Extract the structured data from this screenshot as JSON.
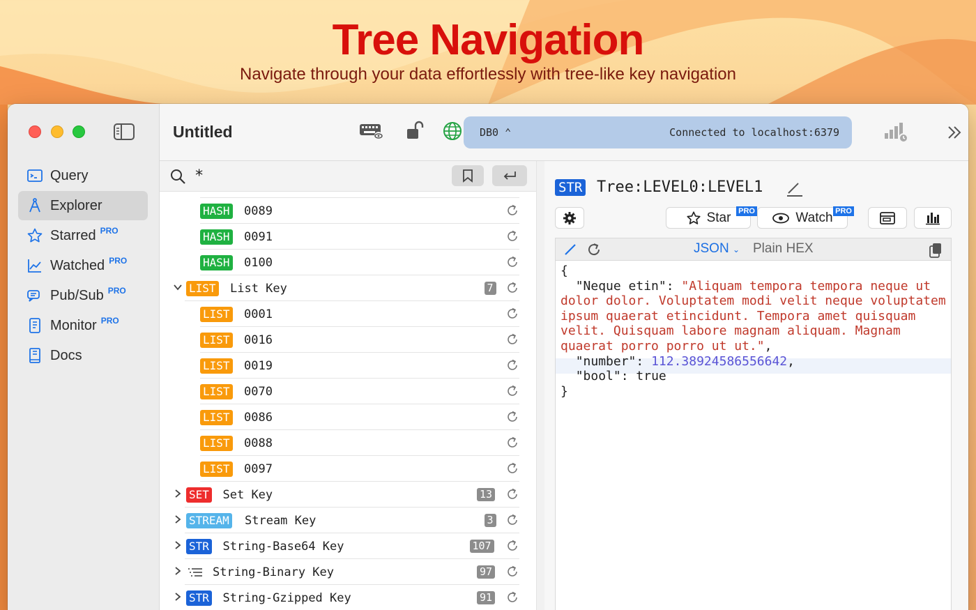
{
  "hero": {
    "title": "Tree Navigation",
    "subtitle": "Navigate through your data effortlessly with tree-like key navigation"
  },
  "window": {
    "title": "Untitled"
  },
  "sidebar": {
    "items": [
      {
        "label": "Query",
        "icon": "terminal-icon",
        "pro": ""
      },
      {
        "label": "Explorer",
        "icon": "compass-icon",
        "pro": "",
        "active": true
      },
      {
        "label": "Starred",
        "icon": "star-icon",
        "pro": "PRO"
      },
      {
        "label": "Watched",
        "icon": "chart-line-icon",
        "pro": "PRO"
      },
      {
        "label": "Pub/Sub",
        "icon": "chat-icon",
        "pro": "PRO"
      },
      {
        "label": "Monitor",
        "icon": "monitor-icon",
        "pro": "PRO"
      },
      {
        "label": "Docs",
        "icon": "book-icon",
        "pro": ""
      }
    ]
  },
  "toolbar": {
    "db": "DB0",
    "status": "Connected to localhost:6379"
  },
  "search": {
    "pattern": "*"
  },
  "tree": {
    "rows": [
      {
        "kind": "child",
        "type": "HASH",
        "name": "0089"
      },
      {
        "kind": "child",
        "type": "HASH",
        "name": "0091"
      },
      {
        "kind": "child",
        "type": "HASH",
        "name": "0100"
      },
      {
        "kind": "parent",
        "expanded": true,
        "type": "LIST",
        "name": "List Key",
        "count": "7"
      },
      {
        "kind": "child",
        "type": "LIST",
        "name": "0001"
      },
      {
        "kind": "child",
        "type": "LIST",
        "name": "0016"
      },
      {
        "kind": "child",
        "type": "LIST",
        "name": "0019"
      },
      {
        "kind": "child",
        "type": "LIST",
        "name": "0070"
      },
      {
        "kind": "child",
        "type": "LIST",
        "name": "0086"
      },
      {
        "kind": "child",
        "type": "LIST",
        "name": "0088"
      },
      {
        "kind": "child",
        "type": "LIST",
        "name": "0097"
      },
      {
        "kind": "parent",
        "expanded": false,
        "type": "SET",
        "name": "Set Key",
        "count": "13"
      },
      {
        "kind": "parent",
        "expanded": false,
        "type": "STREAM",
        "name": "Stream Key",
        "count": "3"
      },
      {
        "kind": "parent",
        "expanded": false,
        "type": "STR",
        "name": "String-Base64 Key",
        "count": "107"
      },
      {
        "kind": "parent",
        "expanded": false,
        "type": "BIN",
        "name": "String-Binary Key",
        "count": "97"
      },
      {
        "kind": "parent",
        "expanded": false,
        "type": "STR",
        "name": "String-Gzipped Key",
        "count": "91"
      }
    ]
  },
  "detail": {
    "type": "STR",
    "key": "Tree:LEVEL0:LEVEL1",
    "star_label": "Star",
    "watch_label": "Watch",
    "pro": "PRO",
    "format_selected": "JSON",
    "format_alt": "Plain HEX",
    "json_lines": {
      "open": "{",
      "k1": "\"Neque etin\"",
      "v1": "\"Aliquam tempora tempora neque ut dolor dolor. Voluptatem modi velit neque voluptatem ipsum quaerat etincidunt. Tempora amet quisquam velit. Quisquam labore magnam aliquam. Magnam quaerat porro porro ut ut.\"",
      "k2": "\"number\"",
      "v2": "112.38924586556642",
      "k3": "\"bool\"",
      "v3": "true",
      "close": "}"
    }
  },
  "colors": {
    "hash": "#1fb141",
    "list": "#f99a0b",
    "set": "#ee2d2d",
    "stream": "#55b4ea",
    "str": "#1b63d8",
    "accent": "#1e73e8"
  }
}
